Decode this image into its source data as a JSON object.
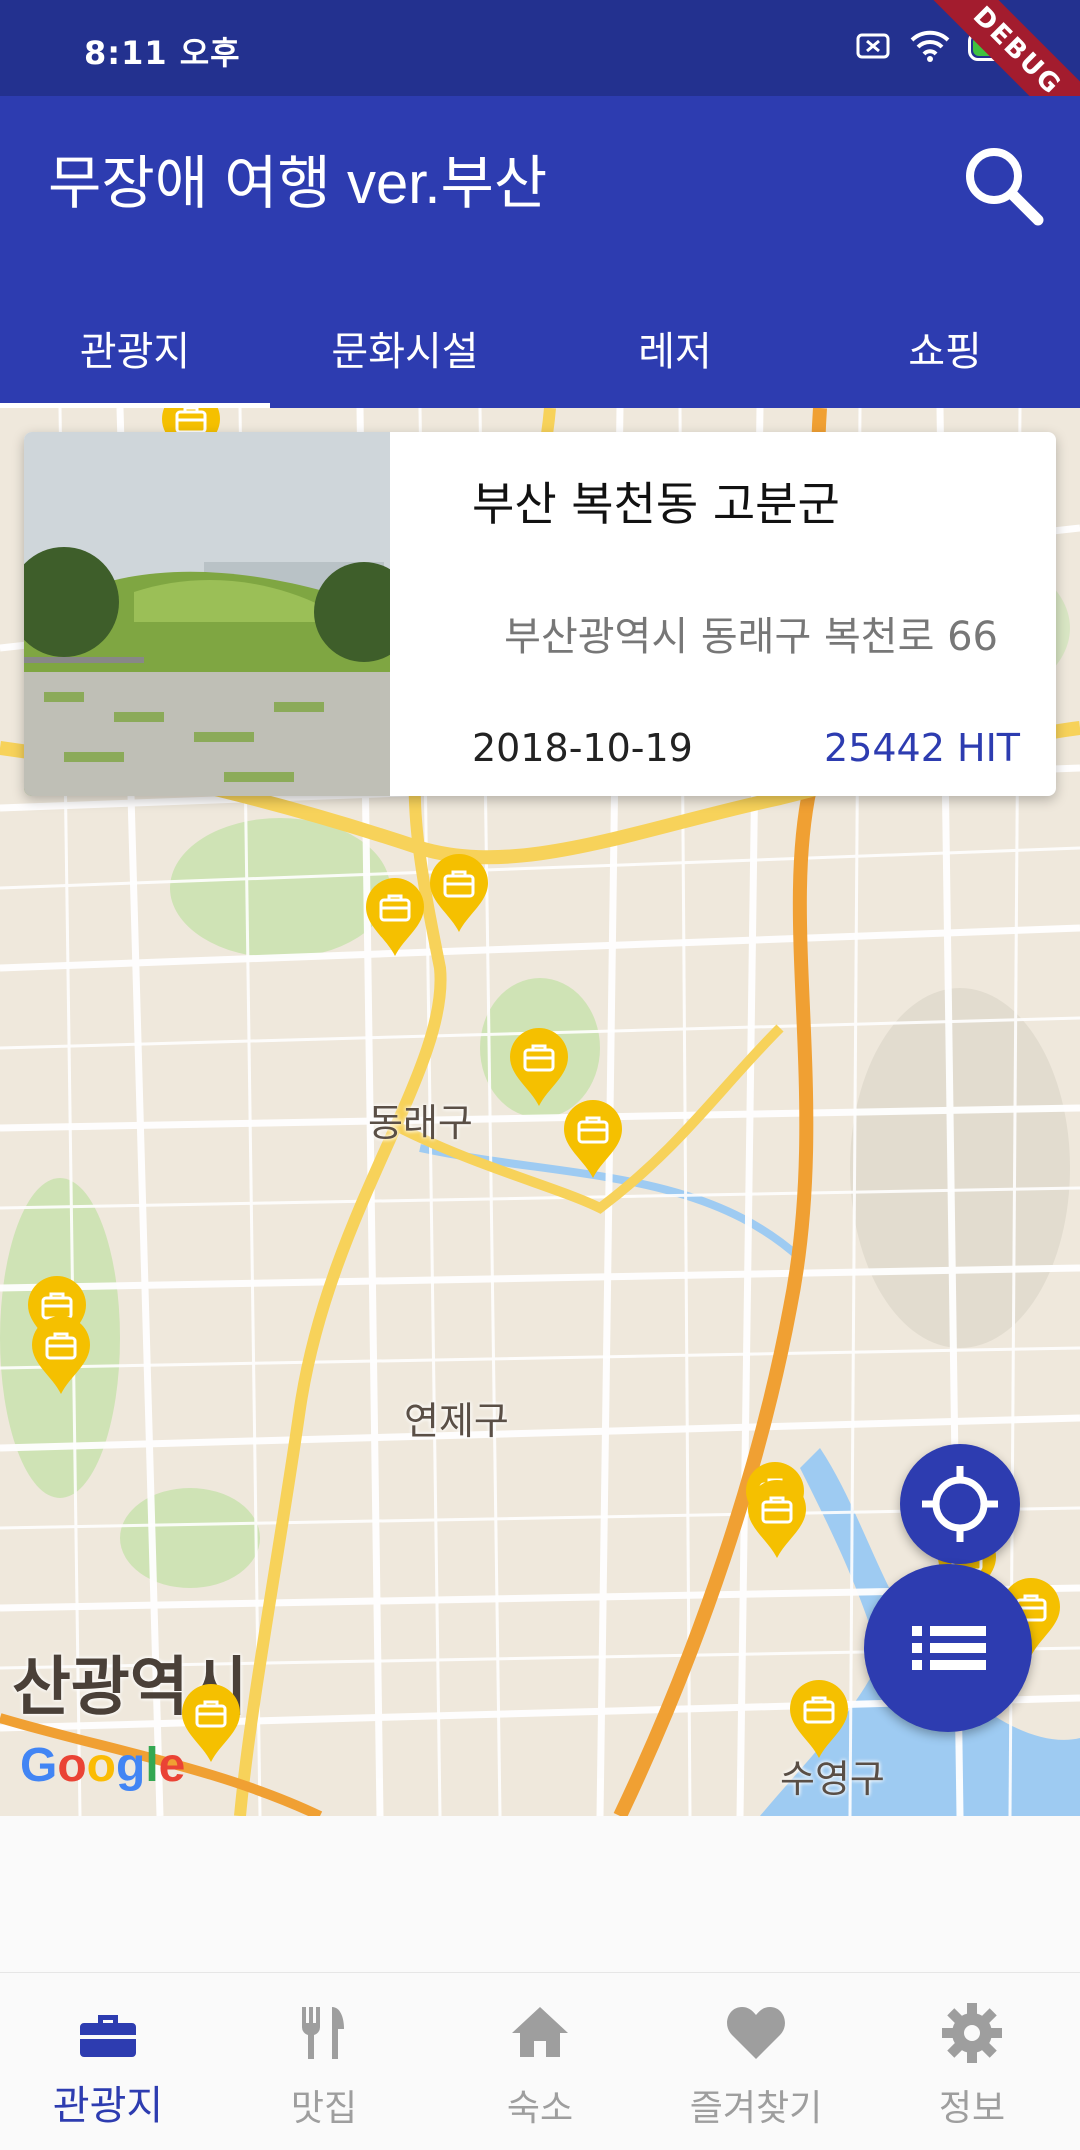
{
  "status_bar": {
    "time": "8:11 오후",
    "battery": "97",
    "debug_label": "DEBUG"
  },
  "app_bar": {
    "title": "무장애 여행 ver.부산",
    "search_icon": "search-icon"
  },
  "tabs": [
    {
      "label": "관광지",
      "active": true
    },
    {
      "label": "문화시설",
      "active": false
    },
    {
      "label": "레저",
      "active": false
    },
    {
      "label": "쇼핑",
      "active": false
    }
  ],
  "card": {
    "name": "부산 복천동 고분군",
    "address": "부산광역시 동래구 복천로 66",
    "date": "2018-10-19",
    "hits": "25442 HIT"
  },
  "map": {
    "labels": [
      "동래구",
      "연제구",
      "산광역시",
      "수영구"
    ],
    "attribution": "Google",
    "marker_icon": "briefcase-marker-icon"
  },
  "fabs": {
    "location_icon": "my-location-icon",
    "list_icon": "list-icon"
  },
  "bottom_nav": [
    {
      "label": "관광지",
      "icon": "briefcase-icon",
      "active": true
    },
    {
      "label": "맛집",
      "icon": "fork-knife-icon",
      "active": false
    },
    {
      "label": "숙소",
      "icon": "home-icon",
      "active": false
    },
    {
      "label": "즐겨찾기",
      "icon": "heart-icon",
      "active": false
    },
    {
      "label": "정보",
      "icon": "gear-icon",
      "active": false
    }
  ],
  "colors": {
    "primary": "#2d3cb0",
    "status_bar": "#23318f",
    "marker": "#f5c000"
  }
}
